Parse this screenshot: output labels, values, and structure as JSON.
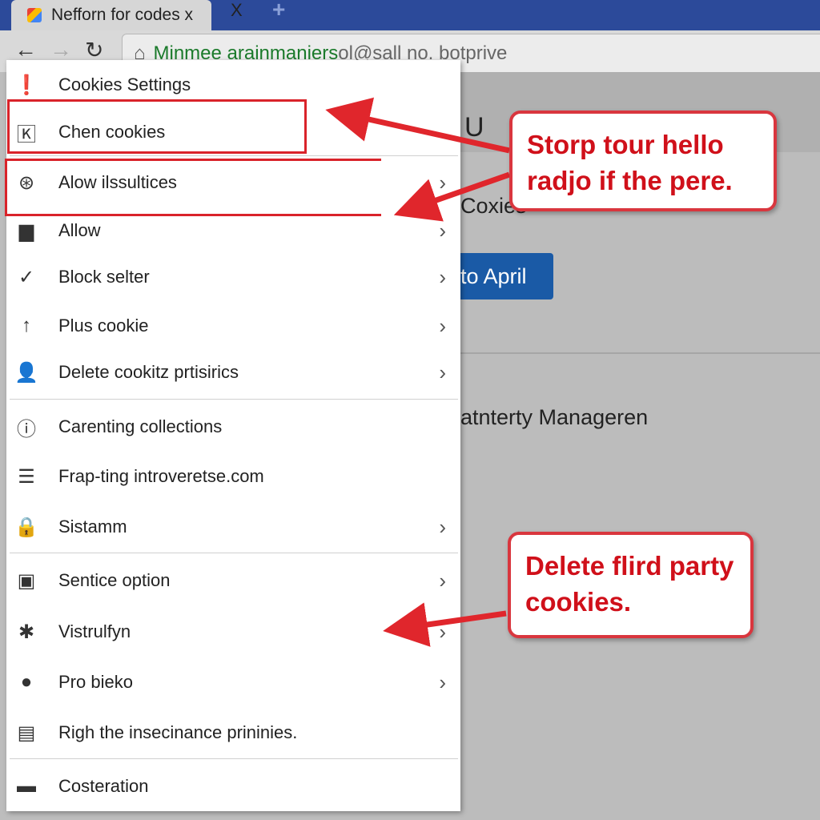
{
  "browser": {
    "tab_title": "Nefforn for codes x",
    "tab_close": "X",
    "new_tab": "+",
    "url_secure": "Minmee arainmaniers",
    "url_rest": "ol@sall no. botprive"
  },
  "page": {
    "heading_fragment": "U",
    "cookies_fragment": "Coxies",
    "button_label": "to April",
    "section_fragment": "atnterty Manageren"
  },
  "menu": {
    "items": [
      {
        "label": "Cookies Settings",
        "icon": "alert-icon",
        "chevron": false
      },
      {
        "label": "Chen cookies",
        "icon": "k-box-icon",
        "chevron": false
      },
      {
        "label": "Alow ilssultices",
        "icon": "asterisk-circle-icon",
        "chevron": true
      },
      {
        "label": "Allow",
        "icon": "store-icon",
        "chevron": true
      },
      {
        "label": "Block selter",
        "icon": "check-circle-icon",
        "chevron": true
      },
      {
        "label": "Plus cookie",
        "icon": "arrow-up-icon",
        "chevron": true
      },
      {
        "label": "Delete cookitz prtisirics",
        "icon": "person-icon",
        "chevron": true
      },
      {
        "label": "Carenting collections",
        "icon": "info-circle-icon",
        "chevron": false
      },
      {
        "label": "Frap-ting introveretse.com",
        "icon": "document-icon",
        "chevron": false
      },
      {
        "label": "Sistamm",
        "icon": "lock-icon",
        "chevron": true
      },
      {
        "label": "Sentice option",
        "icon": "briefcase-icon",
        "chevron": true
      },
      {
        "label": "Vistrulfyn",
        "icon": "aperture-icon",
        "chevron": true
      },
      {
        "label": "Pro bieko",
        "icon": "badge-icon",
        "chevron": true
      },
      {
        "label": "Righ the insecinance prininies.",
        "icon": "panel-icon",
        "chevron": false
      },
      {
        "label": "Costeration",
        "icon": "folder-icon",
        "chevron": false
      }
    ]
  },
  "callouts": {
    "top": "Storp tour hello radjo if the pere.",
    "bottom": "Delete flird party cookies."
  },
  "colors": {
    "annotation_red": "#d9232a",
    "button_blue": "#1a5aa6",
    "tabbar_blue": "#2c4a9a"
  }
}
